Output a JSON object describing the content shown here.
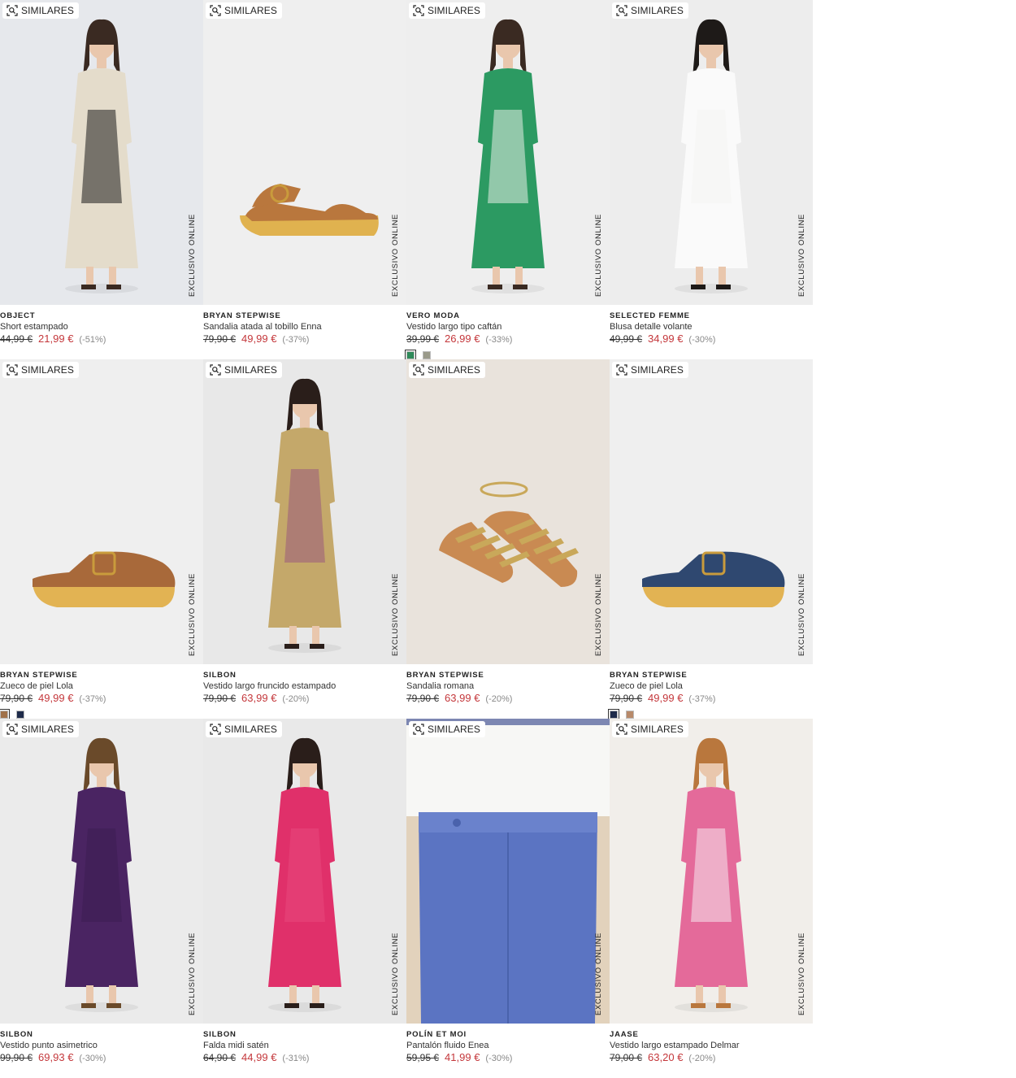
{
  "ui": {
    "similar_label": "SIMILARES",
    "online_label": "EXCLUSIVO ONLINE"
  },
  "products": [
    {
      "brand": "OBJECT",
      "name": "Short estampado",
      "old_price": "44,99 €",
      "new_price": "21,99 €",
      "discount": "(-51%)",
      "swatches": [],
      "bg": "#e6e8ec",
      "kind": "person",
      "palette": [
        "#e4dccb",
        "#1c1c1c",
        "#3a2a22"
      ]
    },
    {
      "brand": "BRYAN STEPWISE",
      "name": "Sandalia atada al tobillo Enna",
      "old_price": "79,90 €",
      "new_price": "49,99 €",
      "discount": "(-37%)",
      "swatches": [],
      "bg": "#efefef",
      "kind": "sandal",
      "palette": [
        "#b9773d",
        "#e0b24f"
      ]
    },
    {
      "brand": "VERO MODA",
      "name": "Vestido largo tipo caftán",
      "old_price": "39,99 €",
      "new_price": "26,99 €",
      "discount": "(-33%)",
      "swatches": [
        "#2f8a5a",
        "#9a9a8a"
      ],
      "bg": "#eeeeee",
      "kind": "person",
      "palette": [
        "#2c9a62",
        "#e8efe6",
        "#3a2a22"
      ]
    },
    {
      "brand": "SELECTED FEMME",
      "name": "Blusa detalle volante",
      "old_price": "49,99 €",
      "new_price": "34,99 €",
      "discount": "(-30%)",
      "swatches": [],
      "bg": "#ededed",
      "kind": "person",
      "palette": [
        "#fafafa",
        "#f4f4f2",
        "#1e1a18"
      ]
    },
    {
      "brand": "BRYAN STEPWISE",
      "name": "Zueco de piel Lola",
      "old_price": "79,90 €",
      "new_price": "49,99 €",
      "discount": "(-37%)",
      "swatches": [
        "#a0714a",
        "#1e2b4a"
      ],
      "bg": "#efefef",
      "kind": "clog",
      "palette": [
        "#a8693a",
        "#e2b353"
      ]
    },
    {
      "brand": "SILBON",
      "name": "Vestido largo fruncido estampado",
      "old_price": "79,90 €",
      "new_price": "63,99 €",
      "discount": "(-20%)",
      "swatches": [],
      "bg": "#e8e8e8",
      "kind": "person",
      "palette": [
        "#c4a86a",
        "#9b5a7c",
        "#2a1e1a"
      ]
    },
    {
      "brand": "BRYAN STEPWISE",
      "name": "Sandalia romana",
      "old_price": "79,90 €",
      "new_price": "63,99 €",
      "discount": "(-20%)",
      "swatches": [],
      "bg": "#e9e3dc",
      "kind": "roman",
      "palette": [
        "#c98a52",
        "#c9a85a"
      ]
    },
    {
      "brand": "BRYAN STEPWISE",
      "name": "Zueco de piel Lola",
      "old_price": "79,90 €",
      "new_price": "49,99 €",
      "discount": "(-37%)",
      "swatches": [
        "#1e2b4a",
        "#b88a6a"
      ],
      "bg": "#efefef",
      "kind": "clog",
      "palette": [
        "#2f4870",
        "#e2b353"
      ]
    },
    {
      "brand": "SILBON",
      "name": "Vestido punto asimetrico",
      "old_price": "99,90 €",
      "new_price": "69,93 €",
      "discount": "(-30%)",
      "swatches": [],
      "bg": "#ebebeb",
      "kind": "person",
      "palette": [
        "#4a2462",
        "#3d1d52",
        "#6a4a2a"
      ]
    },
    {
      "brand": "SILBON",
      "name": "Falda midi satén",
      "old_price": "64,90 €",
      "new_price": "44,99 €",
      "discount": "(-31%)",
      "swatches": [],
      "bg": "#e9e9e9",
      "kind": "person",
      "palette": [
        "#e0306a",
        "#e8487c",
        "#2a1e1a"
      ]
    },
    {
      "brand": "POLÍN ET MOI",
      "name": "Pantalón fluido Enea",
      "old_price": "59,95 €",
      "new_price": "41,99 €",
      "discount": "(-30%)",
      "swatches": [],
      "bg": "#e2d2bc",
      "kind": "pants",
      "palette": [
        "#5b74c2",
        "#f7f7f5"
      ]
    },
    {
      "brand": "JAASE",
      "name": "Vestido largo estampado Delmar",
      "old_price": "79,00 €",
      "new_price": "63,20 €",
      "discount": "(-20%)",
      "swatches": [],
      "bg": "#f1eeea",
      "kind": "person",
      "palette": [
        "#e46a9a",
        "#f6e6ee",
        "#b9773d"
      ]
    }
  ]
}
